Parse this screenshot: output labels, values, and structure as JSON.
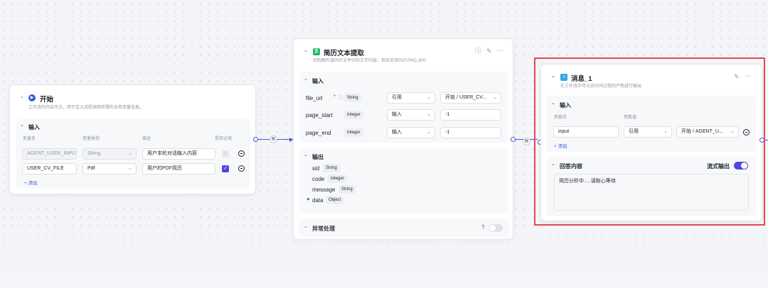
{
  "start_node": {
    "title": "开始",
    "description": "工作流的开启节点，用于定义流程调用所需的业务变量信息。",
    "input_section": "输入",
    "headers": [
      "变量名",
      "变量类型",
      "描述",
      "是否必填"
    ],
    "rows": [
      {
        "name": "AGENT_USER_INPU",
        "type": "String",
        "desc": "用户本轮对话输入内容"
      },
      {
        "name": "USER_CV_FILE",
        "type": "Pdf",
        "desc": "用户的PDF简历"
      }
    ],
    "add_label": "+ 添加"
  },
  "extract_node": {
    "title": "简历文本提取",
    "description": "识别图片或PDF文件中的文字内容，目前支持PDF,PNG,JPG",
    "input_section": "输入",
    "inputs": [
      {
        "name": "file_url",
        "required": "*",
        "type": "String",
        "mode": "引用",
        "value": "开始 / USER_CV..."
      },
      {
        "name": "page_start",
        "type": "Integer",
        "mode": "输入",
        "value": "-1"
      },
      {
        "name": "page_end",
        "type": "Integer",
        "mode": "输入",
        "value": "-1"
      }
    ],
    "output_section": "输出",
    "outputs": [
      {
        "name": "sid",
        "type": "String"
      },
      {
        "name": "code",
        "type": "Integer"
      },
      {
        "name": "message",
        "type": "String"
      },
      {
        "name": "data",
        "type": "Object"
      }
    ],
    "exception_section": "异常处理"
  },
  "message_node": {
    "title": "消息_1",
    "description": "在工作流中可以对中间过程的产物进行输出",
    "input_section": "输入",
    "param_header": "参数名",
    "value_header": "参数值",
    "param": {
      "name": "input",
      "mode": "引用",
      "value": "开始 / AGENT_U..."
    },
    "add_label": "+ 添加",
    "answer_section": "回答内容",
    "stream_label": "流式输出",
    "stream_on": true,
    "answer_text": "简历分析中.....请耐心等待"
  },
  "colors": {
    "accent": "#3b5bdb",
    "start_icon": "#3b5bdb",
    "extract_icon": "#22b573",
    "message_icon": "#2fa6e8",
    "highlight": "#e5484d"
  },
  "icons": {
    "start": "play-circle-icon",
    "extract": "document-scan-icon",
    "message": "message-icon",
    "clipboard": "clipboard-icon"
  }
}
